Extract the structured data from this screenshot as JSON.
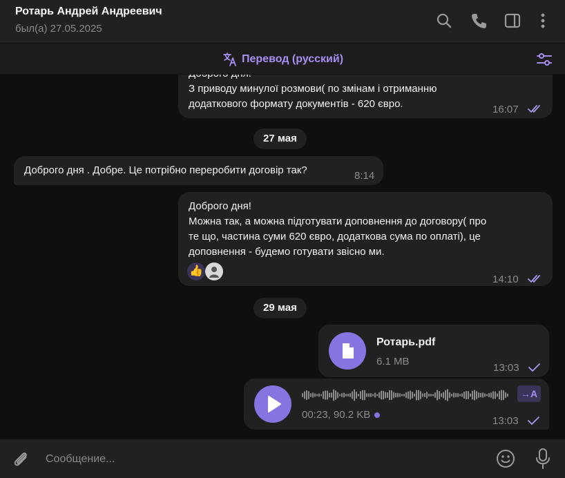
{
  "header": {
    "contact_name": "Ротарь Андрей Андреевич",
    "last_seen": "был(а) 27.05.2025"
  },
  "translate_bar": {
    "label": "Перевод (русский)"
  },
  "messages": [
    {
      "direction": "outgoing",
      "lines": [
        "Доброго дня!",
        "З приводу минулої розмови( по змінам і отриманню",
        "додаткового формату документів - 620 євро."
      ],
      "time": "16:07",
      "status": "read"
    },
    {
      "date_separator": "27 мая"
    },
    {
      "direction": "incoming",
      "lines": [
        "Доброго дня . Добре. Це потрібно переробити договір так?"
      ],
      "time": "8:14"
    },
    {
      "direction": "outgoing",
      "lines": [
        "Доброго дня!",
        "Можна так, а можна підготувати доповнення до договору( про",
        "те що, частина суми 620 євро, додаткова сума по оплаті), це",
        "доповнення - будемо готувати звісно ми."
      ],
      "reactions": [
        "👍"
      ],
      "time": "14:10",
      "status": "read"
    },
    {
      "date_separator": "29 мая"
    },
    {
      "direction": "outgoing",
      "type": "file",
      "file_name": "Ротарь.pdf",
      "file_size": "6.1 MB",
      "time": "13:03",
      "status": "sent"
    },
    {
      "direction": "outgoing",
      "type": "voice",
      "meta": "00:23, 90.2 KB",
      "transcribe_label": "→A",
      "time": "13:03",
      "status": "sent"
    }
  ],
  "footer": {
    "placeholder": "Сообщение..."
  },
  "colors": {
    "accent": "#8774e1",
    "translate_text": "#a98ef2",
    "bubble": "#212121",
    "background": "#0f0f0f",
    "read_check": "#a99af0"
  }
}
